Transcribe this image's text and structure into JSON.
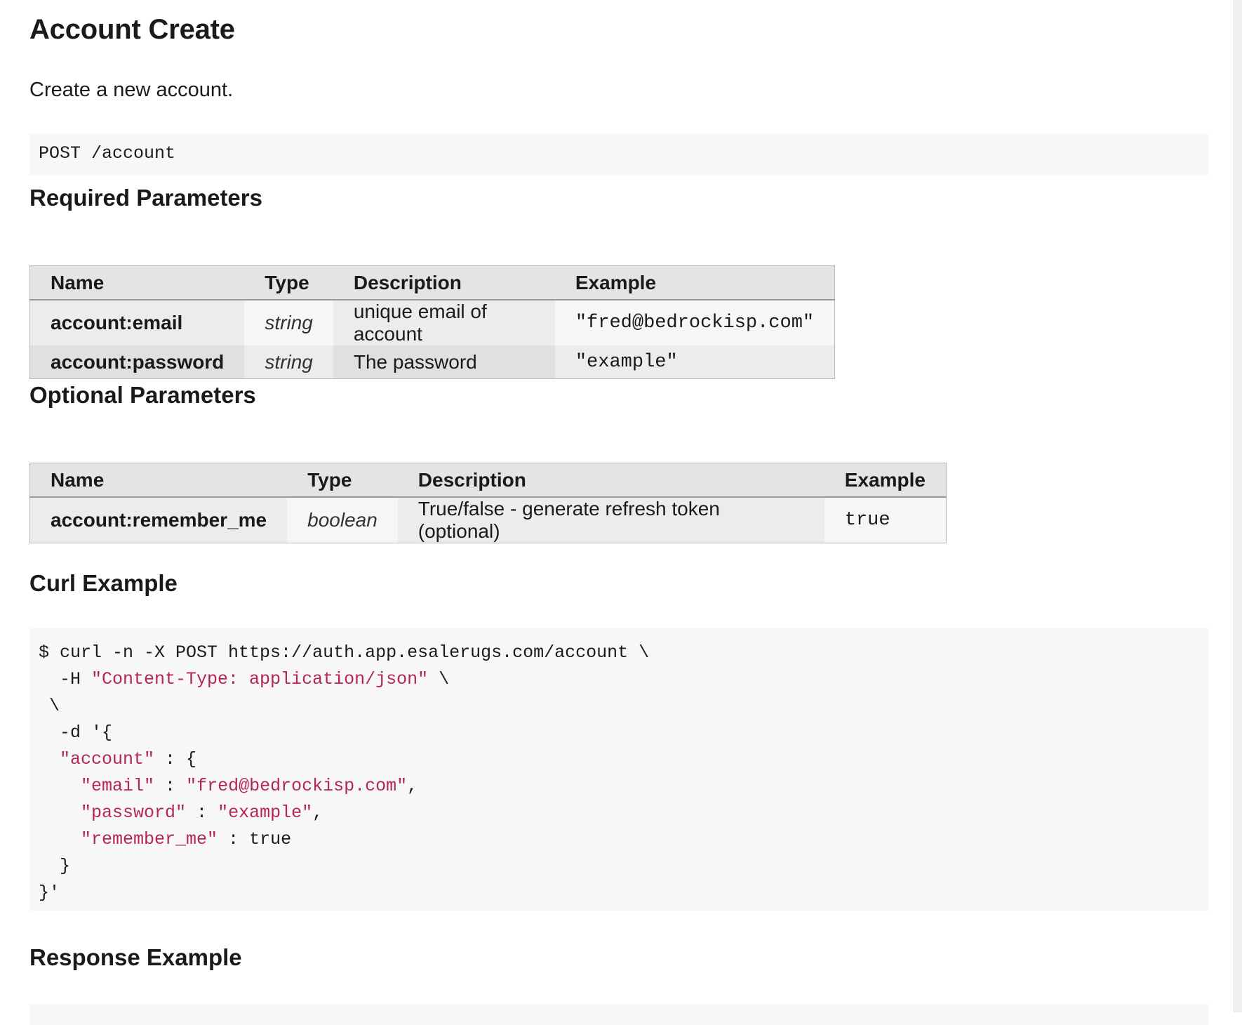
{
  "page": {
    "title": "Account Create",
    "description": "Create a new account.",
    "endpoint": "POST /account"
  },
  "required": {
    "heading": "Required Parameters",
    "headers": [
      "Name",
      "Type",
      "Description",
      "Example"
    ],
    "rows": [
      {
        "name": "account:email",
        "type": "string",
        "description": "unique email of account",
        "example": "\"fred@bedrockisp.com\""
      },
      {
        "name": "account:password",
        "type": "string",
        "description": "The password",
        "example": "\"example\""
      }
    ]
  },
  "optional": {
    "heading": "Optional Parameters",
    "headers": [
      "Name",
      "Type",
      "Description",
      "Example"
    ],
    "rows": [
      {
        "name": "account:remember_me",
        "type": "boolean",
        "description": "True/false - generate refresh token (optional)",
        "example": "true"
      }
    ]
  },
  "curl": {
    "heading": "Curl Example",
    "lines": [
      [
        {
          "t": "$ curl -n -X POST https://auth.app.esalerugs.com/account \\"
        }
      ],
      [
        {
          "t": "  -H "
        },
        {
          "t": "\"Content-Type: application/json\"",
          "s": true
        },
        {
          "t": " \\"
        }
      ],
      [
        {
          "t": " \\"
        }
      ],
      [
        {
          "t": "  -d '{"
        }
      ],
      [
        {
          "t": "  "
        },
        {
          "t": "\"account\"",
          "s": true
        },
        {
          "t": " : {"
        }
      ],
      [
        {
          "t": "    "
        },
        {
          "t": "\"email\"",
          "s": true
        },
        {
          "t": " : "
        },
        {
          "t": "\"fred@bedrockisp.com\"",
          "s": true
        },
        {
          "t": ","
        }
      ],
      [
        {
          "t": "    "
        },
        {
          "t": "\"password\"",
          "s": true
        },
        {
          "t": " : "
        },
        {
          "t": "\"example\"",
          "s": true
        },
        {
          "t": ","
        }
      ],
      [
        {
          "t": "    "
        },
        {
          "t": "\"remember_me\"",
          "s": true
        },
        {
          "t": " : true"
        }
      ],
      [
        {
          "t": "  }"
        }
      ],
      [
        {
          "t": "}'"
        }
      ]
    ]
  },
  "response": {
    "heading": "Response Example"
  },
  "colors": {
    "string": "#b5255a",
    "code_bg": "#f7f7f7",
    "header_bg": "#e4e4e4"
  }
}
